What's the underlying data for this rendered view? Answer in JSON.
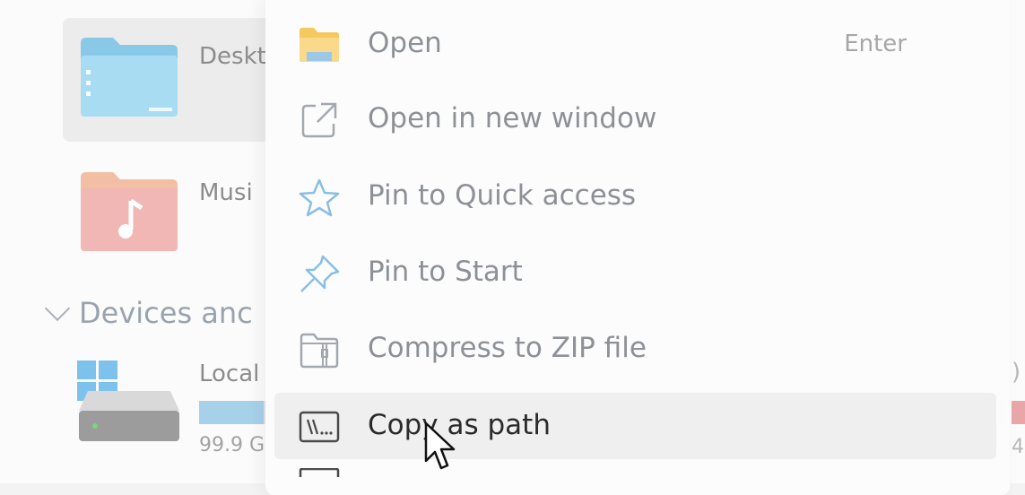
{
  "explorer": {
    "folders": [
      {
        "label": "Deskt",
        "selected": true
      },
      {
        "label": "Musi",
        "selected": false
      }
    ],
    "section": "Devices anc",
    "drive": {
      "label": "Local",
      "free_text": "99.9 G",
      "used_fraction": 0.08
    },
    "edge_glyphs": [
      ")",
      "4"
    ]
  },
  "context_menu": {
    "items": [
      {
        "label": "Open",
        "shortcut": "Enter",
        "icon": "folder-icon"
      },
      {
        "label": "Open in new window",
        "shortcut": "",
        "icon": "open-new-window-icon"
      },
      {
        "label": "Pin to Quick access",
        "shortcut": "",
        "icon": "star-icon"
      },
      {
        "label": "Pin to Start",
        "shortcut": "",
        "icon": "pin-icon"
      },
      {
        "label": "Compress to ZIP file",
        "shortcut": "",
        "icon": "zip-icon"
      },
      {
        "label": "Copy as path",
        "shortcut": "",
        "icon": "copy-path-icon",
        "highlighted": true
      }
    ]
  },
  "colors": {
    "accent": "#a7d0ea",
    "highlight": "#efefef",
    "text_muted": "#8d9196",
    "text_active": "#2b2b2b"
  }
}
